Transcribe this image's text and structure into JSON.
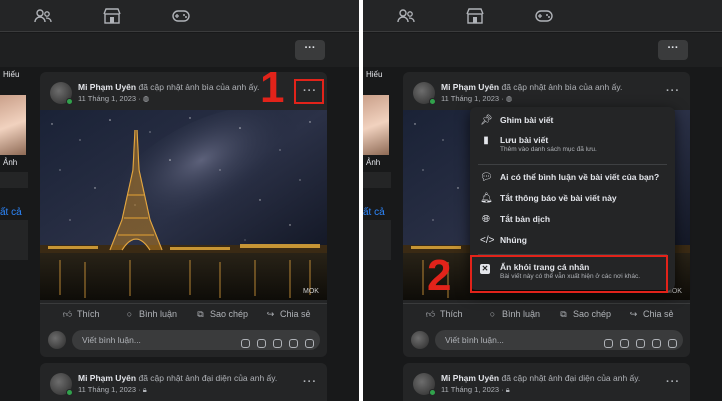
{
  "panels": [
    {
      "annotation_number": "1",
      "sidebar": {
        "name_top": "Hiếu",
        "name_bottom": "Ảnh",
        "link": "ất cả"
      },
      "post": {
        "author": "Mi Phạm Uyên",
        "action": "đã cập nhật ảnh bìa của anh ấy.",
        "date": "11 Tháng 1, 2023 ·",
        "more": "···",
        "watermark": "MOK"
      },
      "actions": {
        "like": "Thích",
        "comment": "Bình luận",
        "copy": "Sao chép",
        "share": "Chia sẻ"
      },
      "comment_placeholder": "Viết bình luận...",
      "post2": {
        "author": "Mi Phạm Uyên",
        "action": "đã cập nhật ảnh đại diện của anh ấy.",
        "date": "11 Tháng 1, 2023 ·",
        "more": "···"
      }
    },
    {
      "annotation_number": "2",
      "post": {
        "author": "Mi Phạm Uyên",
        "action": "đã cập nhật ảnh bìa của anh ấy.",
        "date": "11 Tháng 1, 2023 ·",
        "more": "···",
        "watermark": "MOK"
      },
      "actions": {
        "like": "Thích",
        "comment": "Bình luận",
        "copy": "Sao chép",
        "share": "Chia sẻ"
      },
      "comment_placeholder": "Viết bình luận...",
      "post2": {
        "author": "Mi Phạm Uyên",
        "action": "đã cập nhật ảnh đại diện của anh ấy.",
        "date": "11 Tháng 1, 2023 ·",
        "more": "···"
      },
      "menu": {
        "pin": "Ghim bài viết",
        "save": "Lưu bài viết",
        "save_desc": "Thêm vào danh sách mục đã lưu.",
        "who_comment": "Ai có thể bình luận về bài viết của bạn?",
        "notifications_off": "Tắt thông báo về bài viết này",
        "translation_off": "Tắt bản dịch",
        "embed": "Nhúng",
        "hide": "Ẩn khỏi trang cá nhân",
        "hide_desc": "Bài viết này có thể vẫn xuất hiện ở các nơi khác."
      }
    }
  ],
  "top_more": "···",
  "colors": {
    "bg": "#18191a",
    "card": "#242526",
    "annotation": "#e2231a",
    "text": "#e4e6eb",
    "muted": "#b0b3b8"
  }
}
